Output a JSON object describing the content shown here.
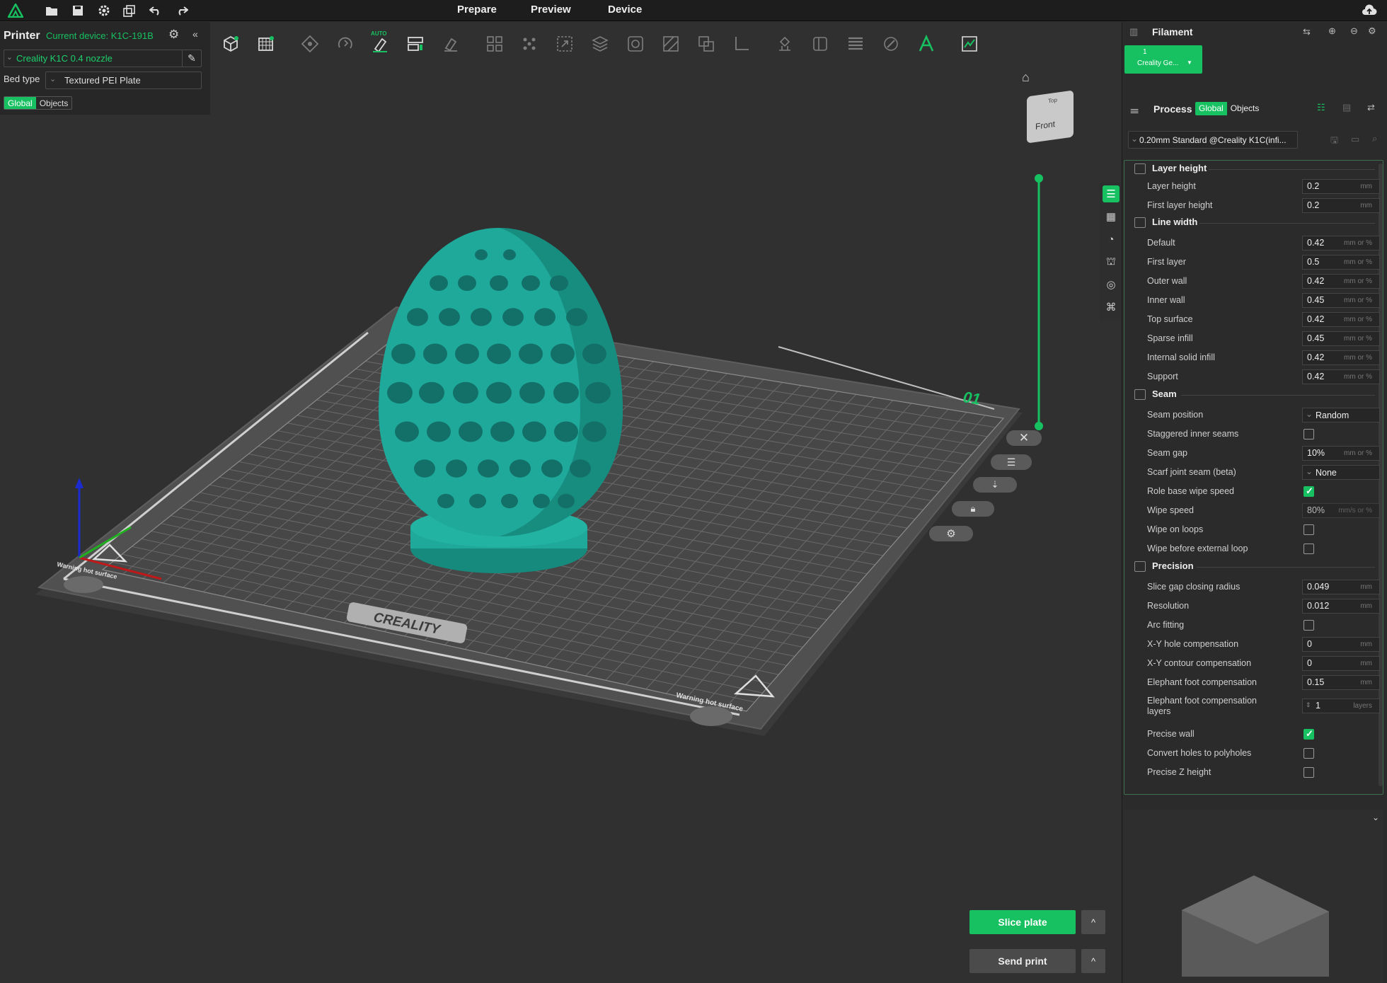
{
  "topbar": {
    "tabs": [
      "Prepare",
      "Preview",
      "Device"
    ]
  },
  "printer": {
    "title": "Printer",
    "current_device": "Current device: K1C-191B",
    "printer_name": "Creality K1C 0.4 nozzle",
    "bed_label": "Bed type",
    "bed_value": "Textured PEI Plate",
    "scope_global": "Global",
    "scope_objects": "Objects"
  },
  "toolbar": {
    "auto_tag": "AUTO"
  },
  "plate": {
    "plate_number": "01",
    "brand_text": "CREALITY",
    "warning_text": "Warning hot surface"
  },
  "filament": {
    "title": "Filament",
    "slot_number": "1",
    "slot_name": "Creality Ge..."
  },
  "process": {
    "title": "Process",
    "scope_global": "Global",
    "scope_objects": "Objects",
    "preset": "0.20mm Standard @Creality K1C(infi..."
  },
  "settings": {
    "sections": {
      "layer_height": "Layer height",
      "line_width": "Line width",
      "seam": "Seam",
      "precision": "Precision"
    },
    "rows": [
      {
        "label": "Layer height",
        "value": "0.2",
        "unit": "mm"
      },
      {
        "label": "First layer height",
        "value": "0.2",
        "unit": "mm"
      },
      {
        "label": "Default",
        "value": "0.42",
        "unit": "mm or %"
      },
      {
        "label": "First layer",
        "value": "0.5",
        "unit": "mm or %"
      },
      {
        "label": "Outer wall",
        "value": "0.42",
        "unit": "mm or %"
      },
      {
        "label": "Inner wall",
        "value": "0.45",
        "unit": "mm or %"
      },
      {
        "label": "Top surface",
        "value": "0.42",
        "unit": "mm or %"
      },
      {
        "label": "Sparse infill",
        "value": "0.45",
        "unit": "mm or %"
      },
      {
        "label": "Internal solid infill",
        "value": "0.42",
        "unit": "mm or %"
      },
      {
        "label": "Support",
        "value": "0.42",
        "unit": "mm or %"
      },
      {
        "label": "Seam position",
        "value": "Random"
      },
      {
        "label": "Staggered inner seams",
        "checked": false
      },
      {
        "label": "Seam gap",
        "value": "10%",
        "unit": "mm or %"
      },
      {
        "label": "Scarf joint seam (beta)",
        "value": "None"
      },
      {
        "label": "Role base wipe speed",
        "checked": true
      },
      {
        "label": "Wipe speed",
        "value": "80%",
        "unit": "mm/s or %"
      },
      {
        "label": "Wipe on loops",
        "checked": false
      },
      {
        "label": "Wipe before external loop",
        "checked": false
      },
      {
        "label": "Slice gap closing radius",
        "value": "0.049",
        "unit": "mm"
      },
      {
        "label": "Resolution",
        "value": "0.012",
        "unit": "mm"
      },
      {
        "label": "Arc fitting",
        "checked": false
      },
      {
        "label": "X-Y hole compensation",
        "value": "0",
        "unit": "mm"
      },
      {
        "label": "X-Y contour compensation",
        "value": "0",
        "unit": "mm"
      },
      {
        "label": "Elephant foot compensation",
        "value": "0.15",
        "unit": "mm"
      },
      {
        "label": "Elephant foot compensation",
        "label2": "layers",
        "value": "1",
        "unit": "layers"
      },
      {
        "label": "Precise wall",
        "checked": true
      },
      {
        "label": "Convert holes to polyholes",
        "checked": false
      },
      {
        "label": "Precise Z height",
        "checked": false
      }
    ]
  },
  "actions": {
    "slice": "Slice plate",
    "send": "Send print",
    "caret": "^"
  },
  "navcube": {
    "front": "Front",
    "top": "Top"
  },
  "colors": {
    "accent": "#17c060",
    "model": "#1fa99a",
    "bg": "#303030"
  }
}
